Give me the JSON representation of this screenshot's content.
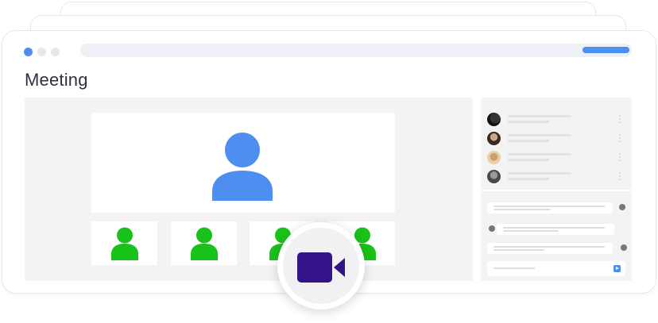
{
  "window": {
    "title": "Meeting"
  },
  "colors": {
    "accent_blue": "#4d8ef0",
    "participant_green": "#19c219",
    "camera_purple": "#33138a",
    "panel_gray": "#f4f3f4"
  },
  "video": {
    "main_participant_icon": "user-icon",
    "thumbnails": [
      {
        "icon": "user-icon"
      },
      {
        "icon": "user-icon"
      },
      {
        "icon": "user-icon"
      },
      {
        "icon": "user-icon"
      }
    ]
  },
  "sidebar": {
    "participants_count": 4,
    "chat_messages_count": 3,
    "send_icon": "send-icon"
  },
  "camera_button": {
    "icon": "video-camera-icon"
  }
}
